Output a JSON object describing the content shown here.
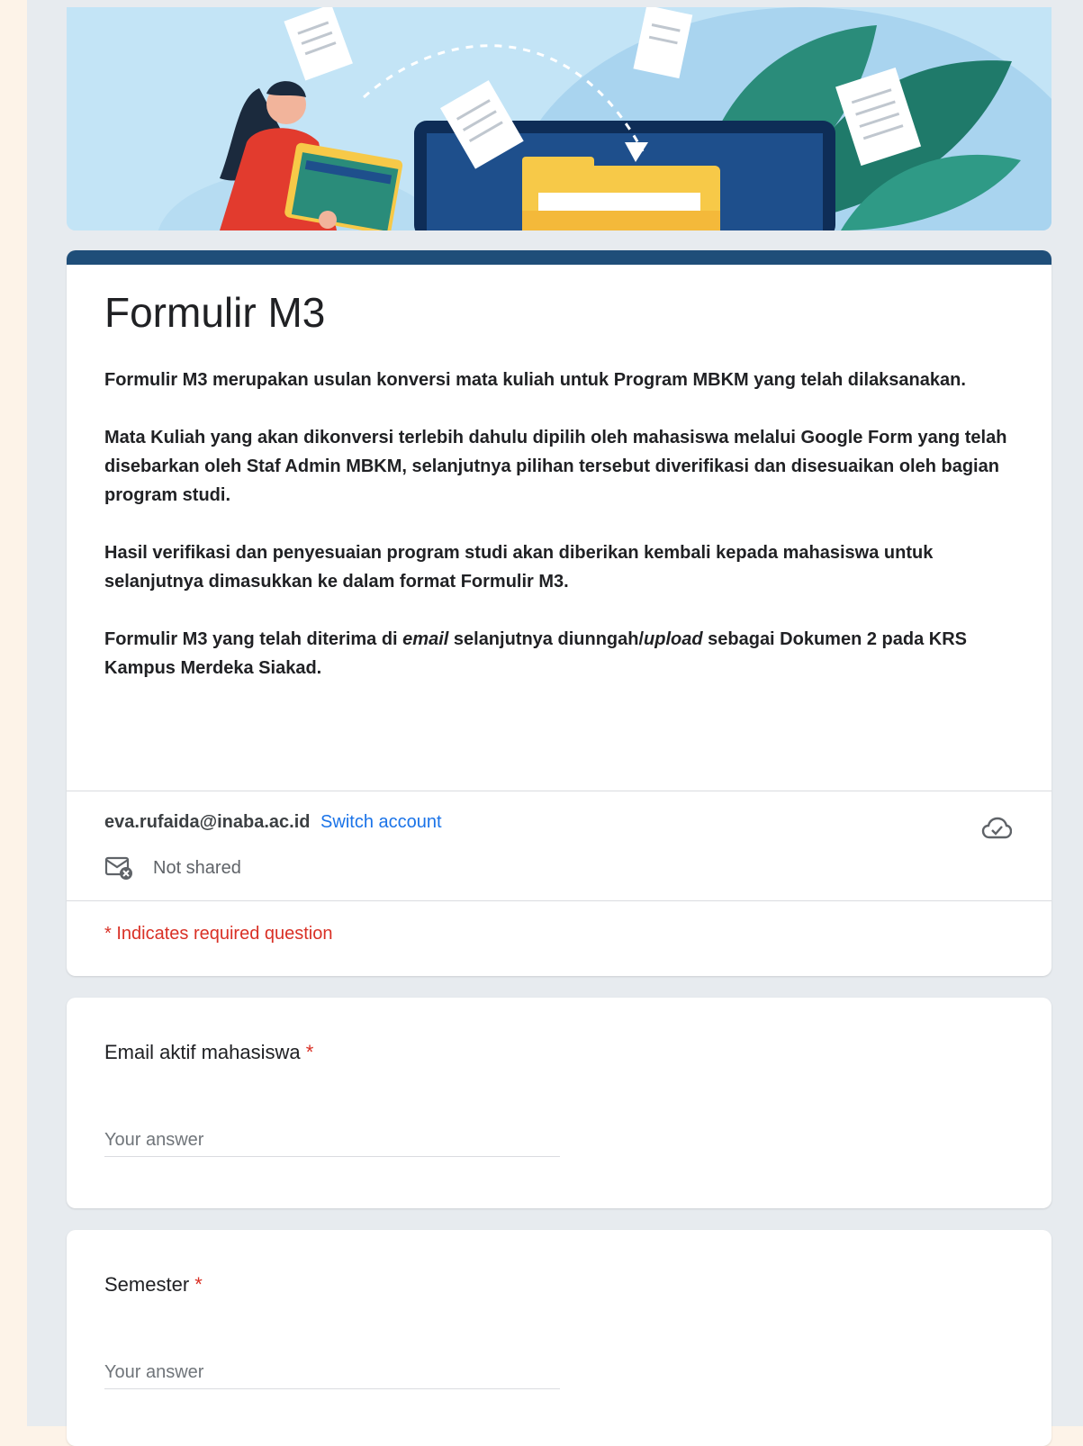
{
  "form": {
    "title": "Formulir M3",
    "description": {
      "p1": "Formulir M3 merupakan usulan konversi mata kuliah untuk Program MBKM yang telah dilaksanakan.",
      "p2": "Mata Kuliah yang akan dikonversi terlebih dahulu dipilih oleh mahasiswa melalui Google Form yang telah disebarkan oleh Staf Admin MBKM, selanjutnya pilihan tersebut diverifikasi dan disesuaikan oleh bagian program studi.",
      "p3": "Hasil verifikasi dan penyesuaian program studi akan diberikan kembali kepada mahasiswa untuk selanjutnya dimasukkan ke dalam format Formulir M3.",
      "p4_a": "Formulir M3 yang telah diterima di ",
      "p4_email": "email",
      "p4_b": " selanjutnya diunngah/",
      "p4_upload": "upload",
      "p4_c": " sebagai Dokumen 2 pada KRS Kampus Merdeka Siakad."
    },
    "account": {
      "email": "eva.rufaida@inaba.ac.id",
      "switch_label": "Switch account",
      "shared_status": "Not shared"
    },
    "required_note": "* Indicates required question",
    "questions": [
      {
        "label": "Email aktif mahasiswa",
        "required_mark": "*",
        "placeholder": "Your answer"
      },
      {
        "label": "Semester",
        "required_mark": "*",
        "placeholder": "Your answer"
      }
    ]
  },
  "icons": {
    "cloud": "cloud-check-icon",
    "mail": "mail-not-shared-icon"
  },
  "colors": {
    "theme": "#1f4e79",
    "link": "#1a73e8",
    "required": "#d93025",
    "page_bg": "#e7ebef"
  }
}
